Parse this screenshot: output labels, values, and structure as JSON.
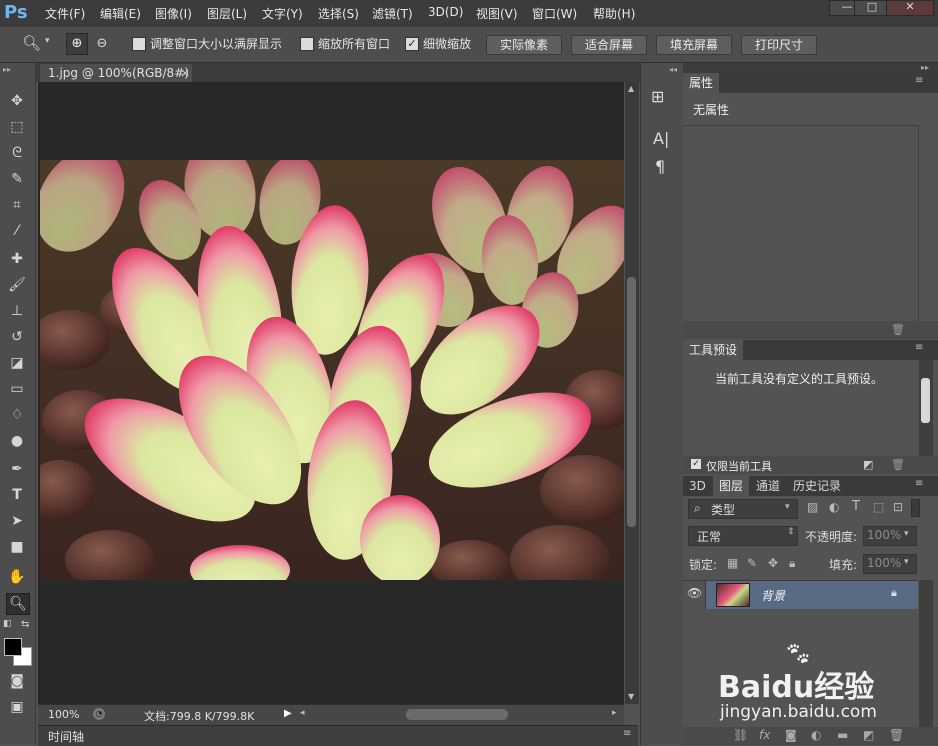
{
  "app": {
    "logo_text": "Ps"
  },
  "menubar": {
    "items": [
      "文件(F)",
      "编辑(E)",
      "图像(I)",
      "图层(L)",
      "文字(Y)",
      "选择(S)",
      "滤镜(T)",
      "3D(D)",
      "视图(V)",
      "窗口(W)",
      "帮助(H)"
    ]
  },
  "window_controls": {
    "minimize": "—",
    "maximize": "□",
    "close": "✕"
  },
  "options_bar": {
    "check_resize_windows": {
      "label": "调整窗口大小以满屏显示",
      "checked": false
    },
    "check_zoom_all": {
      "label": "缩放所有窗口",
      "checked": false
    },
    "check_scrubby": {
      "label": "细微缩放",
      "checked": true
    },
    "btn_actual": "实际像素",
    "btn_fit": "适合屏幕",
    "btn_fill": "填充屏幕",
    "btn_print": "打印尺寸"
  },
  "document": {
    "tab_title": "1.jpg @ 100%(RGB/8#)",
    "tab_close": "×",
    "zoom_level": "100%",
    "doc_info": "文档:799.8 K/799.8K"
  },
  "timeline": {
    "label": "时间轴"
  },
  "properties_panel": {
    "tab": "属性",
    "content": "无属性"
  },
  "tool_presets_panel": {
    "tab": "工具预设",
    "message": "当前工具没有定义的工具预设。",
    "current_tool_only": {
      "label": "仅限当前工具",
      "checked": true
    }
  },
  "layers_panel": {
    "tabs": [
      "3D",
      "图层",
      "通道",
      "历史记录"
    ],
    "active_tab": "图层",
    "filter_kind": "类型",
    "blend_mode": "正常",
    "opacity_label": "不透明度:",
    "opacity_value": "100%",
    "lock_label": "锁定:",
    "fill_label": "填充:",
    "fill_value": "100%",
    "layers": [
      {
        "name": "背景",
        "visible": true,
        "locked": true
      }
    ]
  },
  "watermark": {
    "brand": "Baidu经验",
    "url": "jingyan.baidu.com"
  },
  "colors": {
    "foreground": "#000000",
    "background": "#ffffff",
    "selected_layer": "#596b82"
  }
}
